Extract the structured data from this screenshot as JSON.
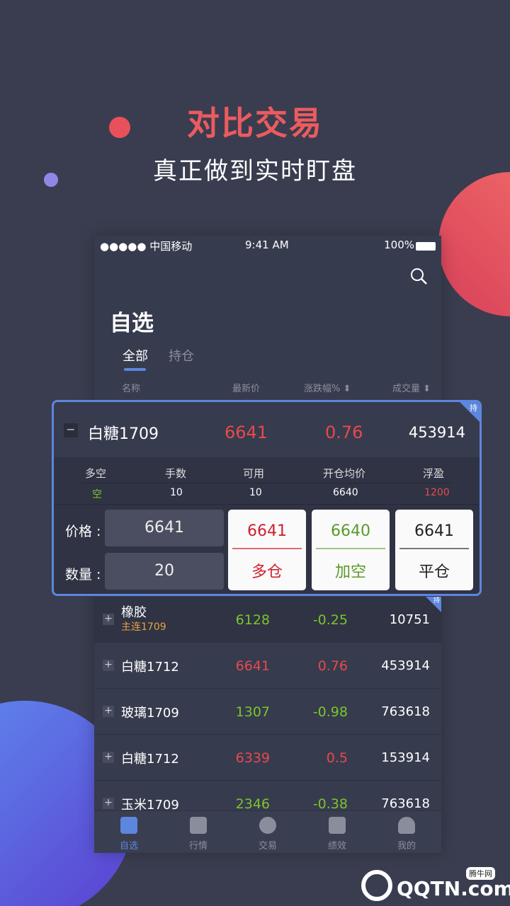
{
  "promo": {
    "headline": "对比交易",
    "subline": "真正做到实时盯盘"
  },
  "status_bar": {
    "carrier": "●●●●● 中国移动",
    "time": "9:41 AM",
    "battery": "100%"
  },
  "page": {
    "title": "自选",
    "tabs": [
      {
        "label": "全部",
        "active": true
      },
      {
        "label": "持仓",
        "active": false
      }
    ],
    "columns": [
      "名称",
      "最新价",
      "涨跌幅%",
      "成交量"
    ]
  },
  "expanded": {
    "name": "白糖1709",
    "price": "6641",
    "change": "0.76",
    "volume": "453914",
    "badge": "持",
    "position_headers": [
      "多空",
      "手数",
      "可用",
      "开仓均价",
      "浮盈"
    ],
    "position_values": [
      "空",
      "10",
      "10",
      "6640",
      "1200"
    ],
    "price_label": "价格 :",
    "price_value": "6641",
    "qty_label": "数量 :",
    "qty_value": "20",
    "buttons": [
      {
        "price": "6641",
        "label": "多仓",
        "color": "#d0202e"
      },
      {
        "price": "6640",
        "label": "加空",
        "color": "#5a9a2a"
      },
      {
        "price": "6641",
        "label": "平仓",
        "color": "#222222"
      }
    ]
  },
  "rows": [
    {
      "name": "橡胶",
      "sub": "主连1709",
      "price": "6128",
      "change": "-0.25",
      "volume": "10751",
      "dir": "down",
      "badge": "持"
    },
    {
      "name": "白糖1712",
      "price": "6641",
      "change": "0.76",
      "volume": "453914",
      "dir": "up"
    },
    {
      "name": "玻璃1709",
      "price": "1307",
      "change": "-0.98",
      "volume": "763618",
      "dir": "down"
    },
    {
      "name": "白糖1712",
      "price": "6339",
      "change": "0.5",
      "volume": "153914",
      "dir": "up"
    },
    {
      "name": "玉米1709",
      "price": "2346",
      "change": "-0.38",
      "volume": "763618",
      "dir": "down"
    }
  ],
  "tabbar": [
    {
      "label": "自选",
      "icon": "list-icon",
      "active": true
    },
    {
      "label": "行情",
      "icon": "bar-chart-icon"
    },
    {
      "label": "交易",
      "icon": "trade-icon"
    },
    {
      "label": "绩效",
      "icon": "performance-icon"
    },
    {
      "label": "我的",
      "icon": "user-icon"
    }
  ],
  "watermark": {
    "text": "QQTN.com",
    "tag": "腾牛网"
  },
  "colors": {
    "up": "#e8494c",
    "down": "#7cc42a",
    "accent": "#5d86de"
  }
}
